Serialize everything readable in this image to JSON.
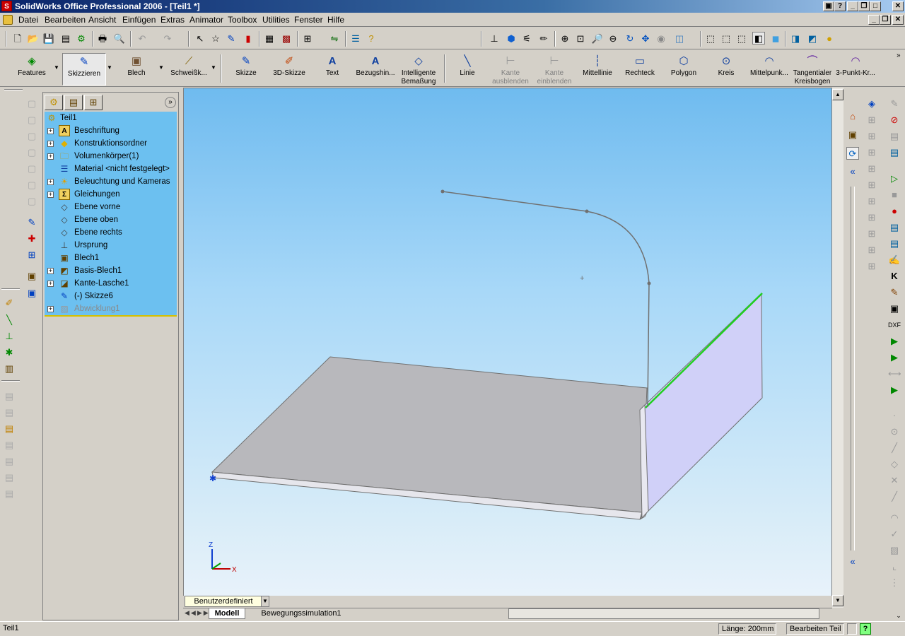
{
  "window": {
    "title": "SolidWorks Office Professional 2006 - [Teil1 *]",
    "app_icon": "solidworks-logo-icon",
    "controls": [
      "minimize-icon",
      "maximize-icon",
      "close-icon"
    ]
  },
  "menu": {
    "items": [
      "Datei",
      "Bearbeiten",
      "Ansicht",
      "Einfügen",
      "Extras",
      "Animator",
      "Toolbox",
      "Utilities",
      "Fenster",
      "Hilfe"
    ]
  },
  "command_manager": {
    "tabs": [
      {
        "label": "Features",
        "icon": "features-icon"
      },
      {
        "label": "Skizzieren",
        "icon": "sketch-icon",
        "active": true
      },
      {
        "label": "Blech",
        "icon": "sheetmetal-icon"
      },
      {
        "label": "Schweißk...",
        "icon": "weldment-icon"
      }
    ],
    "tools": [
      {
        "label": "Skizze",
        "icon": "sketch-icon"
      },
      {
        "label": "3D-Skizze",
        "icon": "3d-sketch-icon"
      },
      {
        "label": "Text",
        "icon": "text-icon"
      },
      {
        "label": "Bezugshin...",
        "icon": "reference-icon"
      },
      {
        "label": "Intelligente Bemaßung",
        "icon": "smart-dimension-icon"
      },
      {
        "label": "Linie",
        "icon": "line-icon"
      },
      {
        "label": "Kante ausblenden",
        "icon": "hide-edge-icon",
        "disabled": true
      },
      {
        "label": "Kante einblenden",
        "icon": "show-edge-icon",
        "disabled": true
      },
      {
        "label": "Mittellinie",
        "icon": "centerline-icon"
      },
      {
        "label": "Rechteck",
        "icon": "rectangle-icon"
      },
      {
        "label": "Polygon",
        "icon": "polygon-icon"
      },
      {
        "label": "Kreis",
        "icon": "circle-icon"
      },
      {
        "label": "Mittelpunk...",
        "icon": "centerpoint-arc-icon"
      },
      {
        "label": "Tangentialer Kreisbogen",
        "icon": "tangent-arc-icon"
      },
      {
        "label": "3-Punkt-Kr...",
        "icon": "3point-arc-icon"
      }
    ]
  },
  "feature_tree": {
    "root": "Teil1",
    "items": [
      {
        "label": "Beschriftung",
        "icon": "annotations-icon",
        "expandable": true
      },
      {
        "label": "Konstruktionsordner",
        "icon": "design-binder-icon",
        "expandable": true
      },
      {
        "label": "Volumenkörper(1)",
        "icon": "solid-bodies-icon",
        "expandable": true
      },
      {
        "label": "Material <nicht festgelegt>",
        "icon": "material-icon",
        "expandable": false
      },
      {
        "label": "Beleuchtung und Kameras",
        "icon": "lighting-icon",
        "expandable": true
      },
      {
        "label": "Gleichungen",
        "icon": "equations-icon",
        "expandable": true
      },
      {
        "label": "Ebene vorne",
        "icon": "plane-icon",
        "expandable": false
      },
      {
        "label": "Ebene oben",
        "icon": "plane-icon",
        "expandable": false
      },
      {
        "label": "Ebene rechts",
        "icon": "plane-icon",
        "expandable": false
      },
      {
        "label": "Ursprung",
        "icon": "origin-icon",
        "expandable": false
      },
      {
        "label": "Blech1",
        "icon": "sheetmetal-icon",
        "expandable": false
      },
      {
        "label": "Basis-Blech1",
        "icon": "base-flange-icon",
        "expandable": true
      },
      {
        "label": "Kante-Lasche1",
        "icon": "edge-flange-icon",
        "expandable": true
      },
      {
        "label": "(-) Skizze6",
        "icon": "sketch-icon",
        "expandable": false
      },
      {
        "label": "Abwicklung1",
        "icon": "flatten-icon",
        "expandable": true,
        "suppressed": true
      }
    ]
  },
  "viewport": {
    "config_dropdown": "Benutzerdefiniert",
    "tabs": [
      "Modell",
      "Bewegungssimulation1"
    ],
    "active_tab": "Modell",
    "triad_labels": [
      "Z",
      "X"
    ]
  },
  "status": {
    "left": "Teil1",
    "length": "Länge: 200mm",
    "mode": "Bearbeiten Teil",
    "help_icon": "help-icon"
  }
}
